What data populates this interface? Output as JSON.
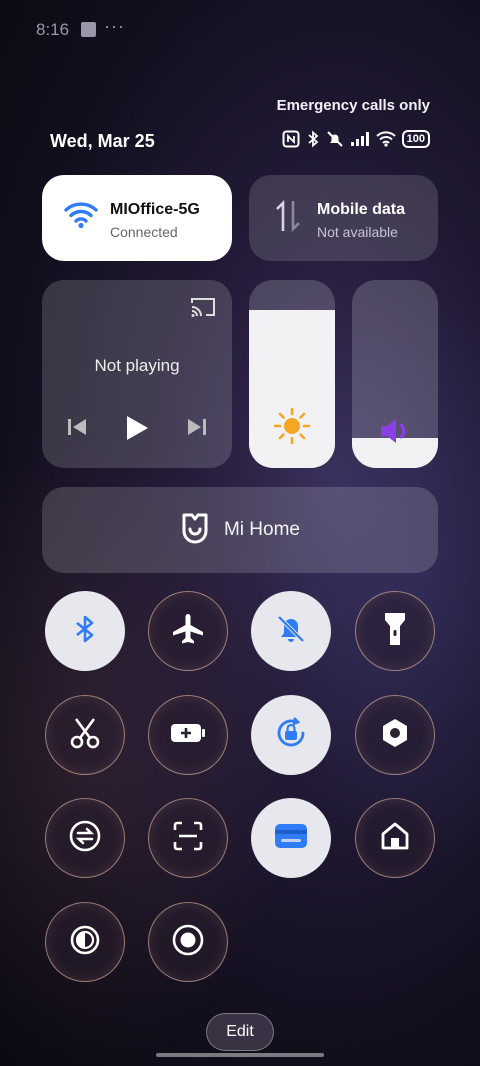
{
  "status_bar": {
    "time": "8:16",
    "dots": "···"
  },
  "header": {
    "emergency_text": "Emergency calls only",
    "date": "Wed, Mar 25",
    "battery": "100"
  },
  "wifi": {
    "title": "MIOffice-5G",
    "subtitle": "Connected",
    "accent": "#2f7cf6"
  },
  "mobile_data": {
    "title": "Mobile data",
    "subtitle": "Not available"
  },
  "media": {
    "label": "Not playing"
  },
  "brightness": {
    "level_fraction": 0.84,
    "icon": "sun-icon"
  },
  "volume": {
    "level_fraction": 0.16,
    "icon": "speaker-icon",
    "accent": "#8b3fe6"
  },
  "mi_home": {
    "label": "Mi Home"
  },
  "toggles": [
    {
      "name": "bluetooth",
      "icon": "bluetooth-icon",
      "on": true
    },
    {
      "name": "airplane-mode",
      "icon": "airplane-icon",
      "on": false
    },
    {
      "name": "silent-mode",
      "icon": "bell-off-icon",
      "on": true
    },
    {
      "name": "flashlight",
      "icon": "flashlight-icon",
      "on": false
    },
    {
      "name": "screenshot",
      "icon": "scissors-icon",
      "on": false
    },
    {
      "name": "battery-saver",
      "icon": "battery-plus-icon",
      "on": false
    },
    {
      "name": "rotation-lock",
      "icon": "rotation-lock-icon",
      "on": true
    },
    {
      "name": "settings-hex",
      "icon": "hexagon-icon",
      "on": false
    },
    {
      "name": "data-saver",
      "icon": "sync-icon",
      "on": false
    },
    {
      "name": "scanner",
      "icon": "scan-icon",
      "on": false
    },
    {
      "name": "wallet",
      "icon": "card-icon",
      "on": true
    },
    {
      "name": "home",
      "icon": "home-icon",
      "on": false
    },
    {
      "name": "dark-mode",
      "icon": "contrast-icon",
      "on": false
    },
    {
      "name": "screen-record",
      "icon": "record-icon",
      "on": false
    }
  ],
  "edit": {
    "label": "Edit"
  }
}
